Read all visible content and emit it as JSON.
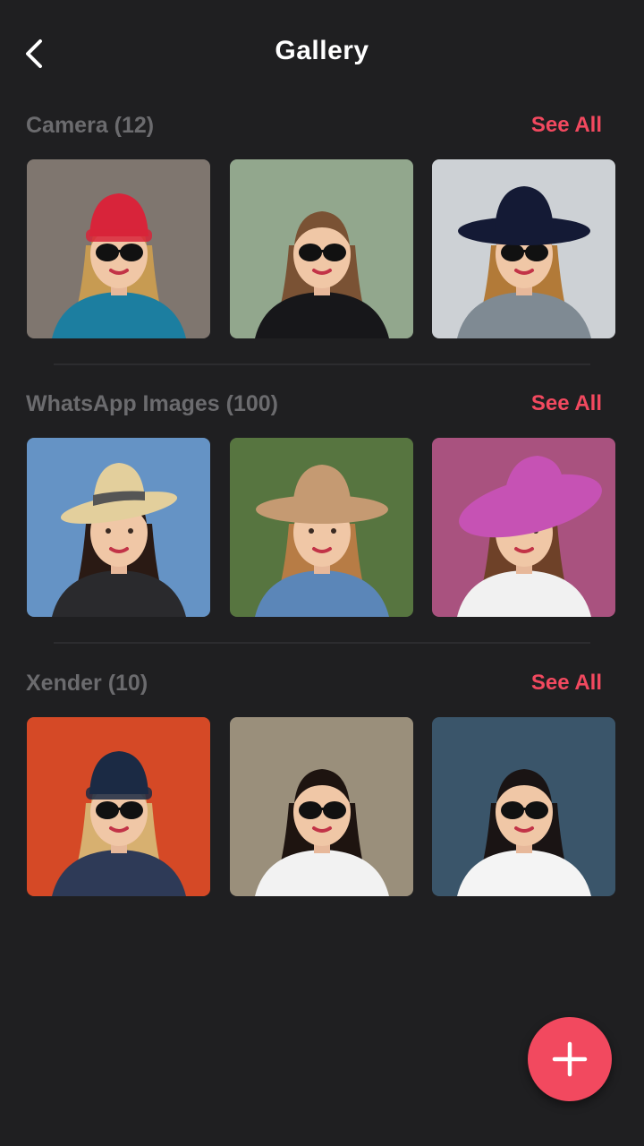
{
  "header": {
    "title": "Gallery",
    "back_icon": "chevron-left-icon"
  },
  "colors": {
    "background": "#1f1f21",
    "accent": "#f2495f",
    "section_label": "#6b6b6e"
  },
  "sections": [
    {
      "label": "Camera (12)",
      "see_all": "See All",
      "photos": [
        {
          "bg": "#8a8179",
          "shirt": "#1c7ea0",
          "hair": "#c79b52",
          "hat": "#d8243a",
          "hat_type": "beanie",
          "sunglasses": true
        },
        {
          "bg": "#9fb69a",
          "shirt": "#17171a",
          "hair": "#7a5234",
          "hat": "none",
          "hat_type": "none",
          "sunglasses": true
        },
        {
          "bg": "#dfe3e8",
          "shirt": "#7f8a93",
          "hair": "#b27a38",
          "hat": "#141a35",
          "hat_type": "wide",
          "sunglasses": true
        }
      ]
    },
    {
      "label": "WhatsApp Images (100)",
      "see_all": "See All",
      "photos": [
        {
          "bg": "#6ea0d6",
          "shirt": "#2a2a2d",
          "hair": "#2a1a14",
          "hat": "#e3cf9c",
          "hat_type": "fedora",
          "sunglasses": false
        },
        {
          "bg": "#5f7f46",
          "shirt": "#5b86b8",
          "hair": "#b77c45",
          "hat": "#c59a72",
          "hat_type": "wide",
          "sunglasses": false
        },
        {
          "bg": "#b85a8a",
          "shirt": "#f1f1f1",
          "hair": "#6e4128",
          "hat": "#c652b4",
          "hat_type": "floppy",
          "sunglasses": false
        }
      ]
    },
    {
      "label": "Xender (10)",
      "see_all": "See All",
      "photos": [
        {
          "bg": "#e8502a",
          "shirt": "#2e3a57",
          "hair": "#d7b070",
          "hat": "#1b2a44",
          "hat_type": "beanie",
          "sunglasses": true
        },
        {
          "bg": "#a89c86",
          "shirt": "#f2f2f2",
          "hair": "#1e1410",
          "hat": "none",
          "hat_type": "none",
          "sunglasses": true
        },
        {
          "bg": "#3f5d74",
          "shirt": "#f4f4f4",
          "hair": "#1a1414",
          "hat": "none",
          "hat_type": "none",
          "sunglasses": true
        }
      ]
    }
  ],
  "fab": {
    "icon": "plus-icon"
  }
}
